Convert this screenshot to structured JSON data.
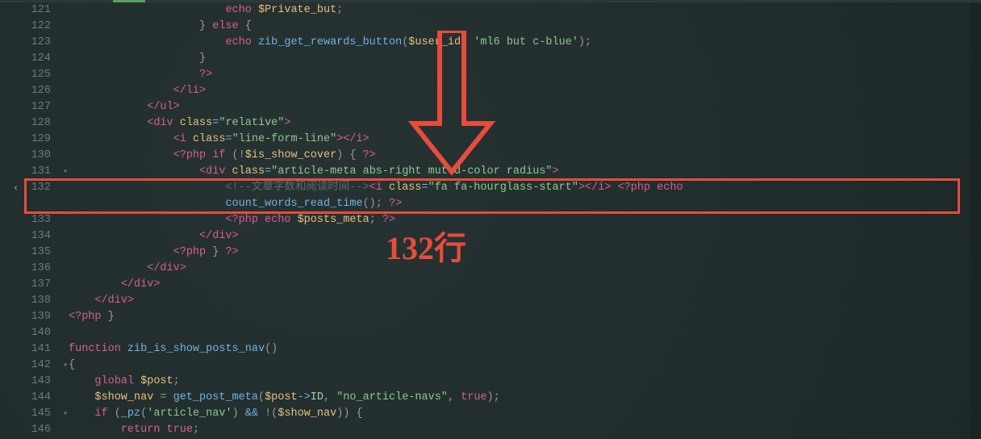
{
  "annotation": {
    "box_line": 132,
    "label": "132行"
  },
  "lines": [
    {
      "num": "121",
      "indent": 24,
      "tokens": [
        {
          "t": "key",
          "v": "echo "
        },
        {
          "t": "var",
          "v": "$Private_but"
        },
        {
          "t": "pun",
          "v": ";"
        }
      ]
    },
    {
      "num": "122",
      "indent": 20,
      "tokens": [
        {
          "t": "pun",
          "v": "} "
        },
        {
          "t": "key",
          "v": "else"
        },
        {
          "t": "pun",
          "v": " {"
        }
      ]
    },
    {
      "num": "123",
      "indent": 24,
      "tokens": [
        {
          "t": "key",
          "v": "echo "
        },
        {
          "t": "fn",
          "v": "zib_get_rewards_button"
        },
        {
          "t": "pun",
          "v": "("
        },
        {
          "t": "var",
          "v": "$user_id"
        },
        {
          "t": "pun",
          "v": ", "
        },
        {
          "t": "str",
          "v": "'ml6 but c-blue'"
        },
        {
          "t": "pun",
          "v": ");"
        }
      ]
    },
    {
      "num": "124",
      "indent": 20,
      "tokens": [
        {
          "t": "pun",
          "v": "}"
        }
      ]
    },
    {
      "num": "125",
      "indent": 20,
      "tokens": [
        {
          "t": "tag",
          "v": "?>"
        }
      ]
    },
    {
      "num": "126",
      "indent": 16,
      "tokens": [
        {
          "t": "tag",
          "v": "</"
        },
        {
          "t": "tag",
          "v": "li"
        },
        {
          "t": "tag",
          "v": ">"
        }
      ]
    },
    {
      "num": "127",
      "indent": 12,
      "tokens": [
        {
          "t": "tag",
          "v": "</"
        },
        {
          "t": "tag",
          "v": "ul"
        },
        {
          "t": "tag",
          "v": ">"
        }
      ]
    },
    {
      "num": "128",
      "indent": 12,
      "tokens": [
        {
          "t": "tag",
          "v": "<"
        },
        {
          "t": "tag",
          "v": "div "
        },
        {
          "t": "var",
          "v": "class"
        },
        {
          "t": "op",
          "v": "="
        },
        {
          "t": "str",
          "v": "\"relative\""
        },
        {
          "t": "tag",
          "v": ">"
        }
      ]
    },
    {
      "num": "129",
      "indent": 16,
      "tokens": [
        {
          "t": "tag",
          "v": "<"
        },
        {
          "t": "tag",
          "v": "i "
        },
        {
          "t": "var",
          "v": "class"
        },
        {
          "t": "op",
          "v": "="
        },
        {
          "t": "str",
          "v": "\"line-form-line\""
        },
        {
          "t": "tag",
          "v": "></"
        },
        {
          "t": "tag",
          "v": "i"
        },
        {
          "t": "tag",
          "v": ">"
        }
      ]
    },
    {
      "num": "130",
      "indent": 16,
      "tokens": [
        {
          "t": "tag",
          "v": "<?"
        },
        {
          "t": "key",
          "v": "php "
        },
        {
          "t": "key",
          "v": "if "
        },
        {
          "t": "pun",
          "v": "(!"
        },
        {
          "t": "var",
          "v": "$is_show_cover"
        },
        {
          "t": "pun",
          "v": ") { "
        },
        {
          "t": "tag",
          "v": "?>"
        }
      ]
    },
    {
      "num": "131",
      "indent": 20,
      "fold": true,
      "tokens": [
        {
          "t": "tag",
          "v": "<"
        },
        {
          "t": "tag",
          "v": "div "
        },
        {
          "t": "var",
          "v": "class"
        },
        {
          "t": "op",
          "v": "="
        },
        {
          "t": "str",
          "v": "\"article-meta abs-right muted-color radius\""
        },
        {
          "t": "tag",
          "v": ">"
        }
      ]
    },
    {
      "num": "132",
      "indent": 24,
      "tokens": [
        {
          "t": "cmt",
          "v": "<!--文章字数和阅读时间-->"
        },
        {
          "t": "tag",
          "v": "<"
        },
        {
          "t": "tag",
          "v": "i "
        },
        {
          "t": "var",
          "v": "class"
        },
        {
          "t": "op",
          "v": "="
        },
        {
          "t": "str",
          "v": "\"fa fa-hourglass-start\""
        },
        {
          "t": "tag",
          "v": "></"
        },
        {
          "t": "tag",
          "v": "i"
        },
        {
          "t": "tag",
          "v": "> "
        },
        {
          "t": "tag",
          "v": "<?"
        },
        {
          "t": "key",
          "v": "php "
        },
        {
          "t": "key",
          "v": "echo"
        }
      ]
    },
    {
      "num": "",
      "indent": 24,
      "tokens": [
        {
          "t": "fn",
          "v": "count_words_read_time"
        },
        {
          "t": "pun",
          "v": "(); "
        },
        {
          "t": "tag",
          "v": "?>"
        }
      ]
    },
    {
      "num": "133",
      "indent": 24,
      "tokens": [
        {
          "t": "tag",
          "v": "<?"
        },
        {
          "t": "key",
          "v": "php "
        },
        {
          "t": "key",
          "v": "echo "
        },
        {
          "t": "var",
          "v": "$posts_meta"
        },
        {
          "t": "pun",
          "v": "; "
        },
        {
          "t": "tag",
          "v": "?>"
        }
      ]
    },
    {
      "num": "134",
      "indent": 20,
      "tokens": [
        {
          "t": "tag",
          "v": "</"
        },
        {
          "t": "tag",
          "v": "div"
        },
        {
          "t": "tag",
          "v": ">"
        }
      ]
    },
    {
      "num": "135",
      "indent": 16,
      "tokens": [
        {
          "t": "tag",
          "v": "<?"
        },
        {
          "t": "key",
          "v": "php "
        },
        {
          "t": "pun",
          "v": "} "
        },
        {
          "t": "tag",
          "v": "?>"
        }
      ]
    },
    {
      "num": "136",
      "indent": 12,
      "tokens": [
        {
          "t": "tag",
          "v": "</"
        },
        {
          "t": "tag",
          "v": "div"
        },
        {
          "t": "tag",
          "v": ">"
        }
      ]
    },
    {
      "num": "137",
      "indent": 8,
      "tokens": [
        {
          "t": "tag",
          "v": "</"
        },
        {
          "t": "tag",
          "v": "div"
        },
        {
          "t": "tag",
          "v": ">"
        }
      ]
    },
    {
      "num": "138",
      "indent": 4,
      "tokens": [
        {
          "t": "tag",
          "v": "</"
        },
        {
          "t": "tag",
          "v": "div"
        },
        {
          "t": "tag",
          "v": ">"
        }
      ]
    },
    {
      "num": "139",
      "indent": 0,
      "tokens": [
        {
          "t": "tag",
          "v": "<?"
        },
        {
          "t": "key",
          "v": "php "
        },
        {
          "t": "pun",
          "v": "}"
        }
      ]
    },
    {
      "num": "140",
      "indent": 0,
      "tokens": []
    },
    {
      "num": "141",
      "indent": 0,
      "tokens": [
        {
          "t": "key",
          "v": "function "
        },
        {
          "t": "fn",
          "v": "zib_is_show_posts_nav"
        },
        {
          "t": "pun",
          "v": "()"
        }
      ]
    },
    {
      "num": "142",
      "indent": 0,
      "fold": true,
      "tokens": [
        {
          "t": "pun",
          "v": "{"
        }
      ]
    },
    {
      "num": "143",
      "indent": 4,
      "tokens": [
        {
          "t": "key",
          "v": "global "
        },
        {
          "t": "var",
          "v": "$post"
        },
        {
          "t": "pun",
          "v": ";"
        }
      ]
    },
    {
      "num": "144",
      "indent": 4,
      "tokens": [
        {
          "t": "var",
          "v": "$show_nav"
        },
        {
          "t": "pun",
          "v": " = "
        },
        {
          "t": "fn",
          "v": "get_post_meta"
        },
        {
          "t": "pun",
          "v": "("
        },
        {
          "t": "var",
          "v": "$post"
        },
        {
          "t": "op",
          "v": "->"
        },
        {
          "t": "w",
          "v": "ID"
        },
        {
          "t": "pun",
          "v": ", "
        },
        {
          "t": "str",
          "v": "\"no_article-navs\""
        },
        {
          "t": "pun",
          "v": ", "
        },
        {
          "t": "key",
          "v": "true"
        },
        {
          "t": "pun",
          "v": ");"
        }
      ]
    },
    {
      "num": "145",
      "indent": 4,
      "fold": true,
      "tokens": [
        {
          "t": "key",
          "v": "if "
        },
        {
          "t": "pun",
          "v": "("
        },
        {
          "t": "fn",
          "v": "_pz"
        },
        {
          "t": "pun",
          "v": "("
        },
        {
          "t": "str",
          "v": "'article_nav'"
        },
        {
          "t": "pun",
          "v": ") "
        },
        {
          "t": "op",
          "v": "&&"
        },
        {
          "t": "pun",
          "v": " !("
        },
        {
          "t": "var",
          "v": "$show_nav"
        },
        {
          "t": "pun",
          "v": ")) {"
        }
      ]
    },
    {
      "num": "146",
      "indent": 8,
      "tokens": [
        {
          "t": "key",
          "v": "return "
        },
        {
          "t": "key",
          "v": "true"
        },
        {
          "t": "pun",
          "v": ";"
        }
      ]
    }
  ]
}
